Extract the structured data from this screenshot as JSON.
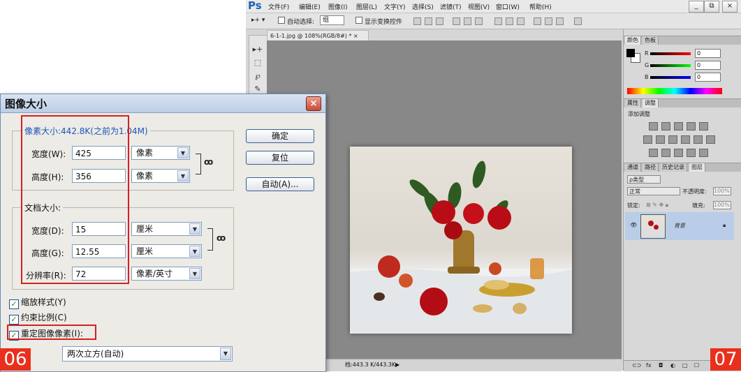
{
  "ps": {
    "logo": "Ps",
    "menu": [
      "文件(F)",
      "编辑(E)",
      "图像(I)",
      "图层(L)",
      "文字(Y)",
      "选择(S)",
      "滤镜(T)",
      "视图(V)",
      "窗口(W)",
      "帮助(H)"
    ],
    "window_buttons": [
      "_",
      "⧉",
      "×"
    ],
    "options": {
      "auto_select_label": "自动选择:",
      "auto_select_value": "组",
      "show_transform_label": "显示变换控件"
    },
    "doc_tab": "6-1-1.jpg @ 108%(RGB/8#) * ×",
    "status": "档:443.3 K/443.3K"
  },
  "panels": {
    "color_tabs": [
      "颜色",
      "色板"
    ],
    "color_rows": [
      {
        "channel": "R",
        "value": "0",
        "color": "#d21818"
      },
      {
        "channel": "G",
        "value": "0",
        "color": "#18a018"
      },
      {
        "channel": "B",
        "value": "0",
        "color": "#1830d2"
      }
    ],
    "adjust_tabs": [
      "属性",
      "调整"
    ],
    "adjust_title": "添加调整",
    "layer_tabs": [
      "通道",
      "路径",
      "历史记录",
      "图层"
    ],
    "kind_label": "ρ类型",
    "blend_mode": "正常",
    "opacity_label": "不透明度:",
    "opacity_value": "100%",
    "lock_label": "锁定:",
    "fill_label": "填充:",
    "fill_value": "100%",
    "layer_name": "背景",
    "layer_footer": [
      "⊂⊃",
      "fx",
      "◘",
      "◐",
      "□",
      "☐"
    ]
  },
  "dialog": {
    "title": "图像大小",
    "close_icon": "×",
    "pixel_legend": "像素大小:442.8K(之前为1.04M)",
    "width_label": "宽度(W):",
    "width_value": "425",
    "width_unit": "像素",
    "height_label": "高度(H):",
    "height_value": "356",
    "height_unit": "像素",
    "doc_legend": "文档大小:",
    "doc_width_label": "宽度(D):",
    "doc_width_value": "15",
    "doc_width_unit": "厘米",
    "doc_height_label": "高度(G):",
    "doc_height_value": "12.55",
    "doc_height_unit": "厘米",
    "resolution_label": "分辨率(R):",
    "resolution_value": "72",
    "resolution_unit": "像素/英寸",
    "ok": "确定",
    "reset": "复位",
    "auto": "自动(A)...",
    "scale_styles": "缩放样式(Y)",
    "constrain": "约束比例(C)",
    "resample": "重定图像像素(I):",
    "resample_method": "两次立方(自动)",
    "check_mark": "✓",
    "link_icon": "ꝏ"
  },
  "badges": {
    "left": "06",
    "right": "07"
  },
  "colors": {
    "accent_red": "#d42020",
    "badge": "#e8301c",
    "link_blue": "#1c54b8"
  }
}
